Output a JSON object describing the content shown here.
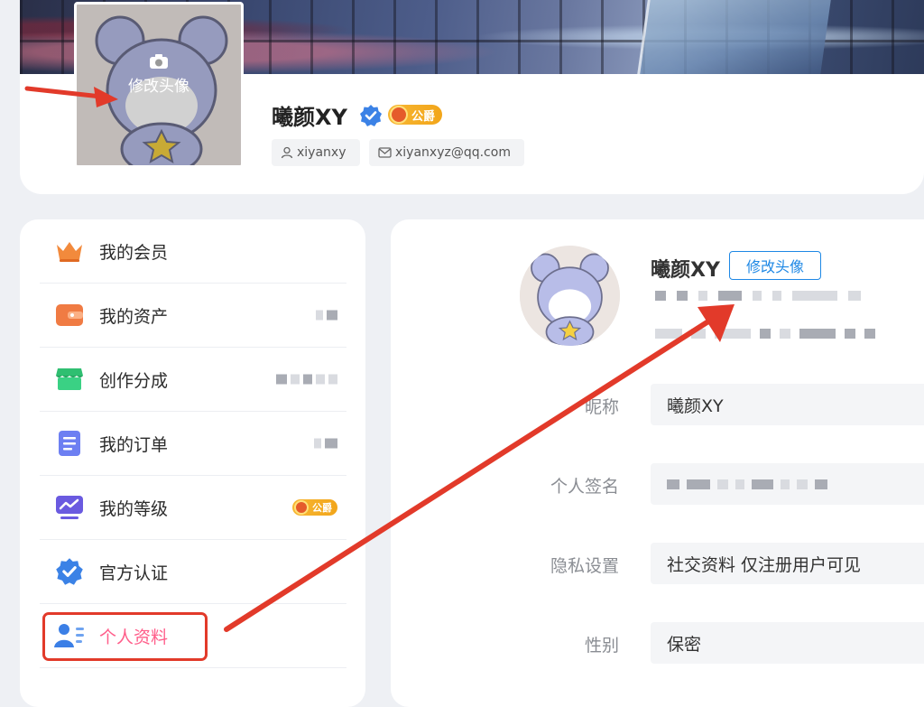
{
  "profile": {
    "username": "曦颜XY",
    "rank_badge": "公爵",
    "account": "xiyanxy",
    "email": "xiyanxyz@qq.com",
    "avatar_overlay_label": "修改头像"
  },
  "sidebar": {
    "items": [
      {
        "label": "我的会员",
        "icon": "crown-icon"
      },
      {
        "label": "我的资产",
        "icon": "wallet-icon"
      },
      {
        "label": "创作分成",
        "icon": "shop-icon"
      },
      {
        "label": "我的订单",
        "icon": "order-list-icon"
      },
      {
        "label": "我的等级",
        "icon": "level-chart-icon",
        "badge": "公爵"
      },
      {
        "label": "官方认证",
        "icon": "verified-shield-icon"
      },
      {
        "label": "个人资料",
        "icon": "user-profile-icon",
        "active": true
      }
    ]
  },
  "main": {
    "name": "曦颜XY",
    "change_avatar_button": "修改头像",
    "fields": [
      {
        "label": "昵称",
        "value": "曦颜XY"
      },
      {
        "label": "个人签名",
        "value": ""
      },
      {
        "label": "隐私设置",
        "value": "社交资料 仅注册用户可见"
      },
      {
        "label": "性别",
        "value": "保密"
      }
    ]
  },
  "colors": {
    "accent_blue": "#1e88e5",
    "active_pink": "#ff5e8a",
    "annotation_red": "#e23a2a",
    "badge_gold": "#f2a51a"
  }
}
